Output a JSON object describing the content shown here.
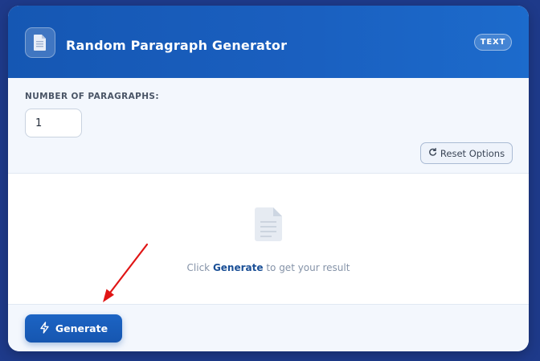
{
  "header": {
    "title": "Random Paragraph Generator",
    "badge": "TEXT",
    "icon": "document-icon"
  },
  "options": {
    "paragraphs_label": "NUMBER OF PARAGRAPHS:",
    "paragraphs_value": "1",
    "reset_label": "Reset Options",
    "reset_icon": "refresh-icon"
  },
  "result": {
    "hint_prefix": "Click",
    "hint_link": "Generate",
    "hint_suffix": "to get your result",
    "icon": "document-icon"
  },
  "footer": {
    "generate_label": "Generate",
    "generate_icon": "lightning-icon"
  },
  "colors": {
    "accent": "#1a5fbf",
    "background": "#1e3a8a",
    "annotation_arrow": "#e01515"
  }
}
